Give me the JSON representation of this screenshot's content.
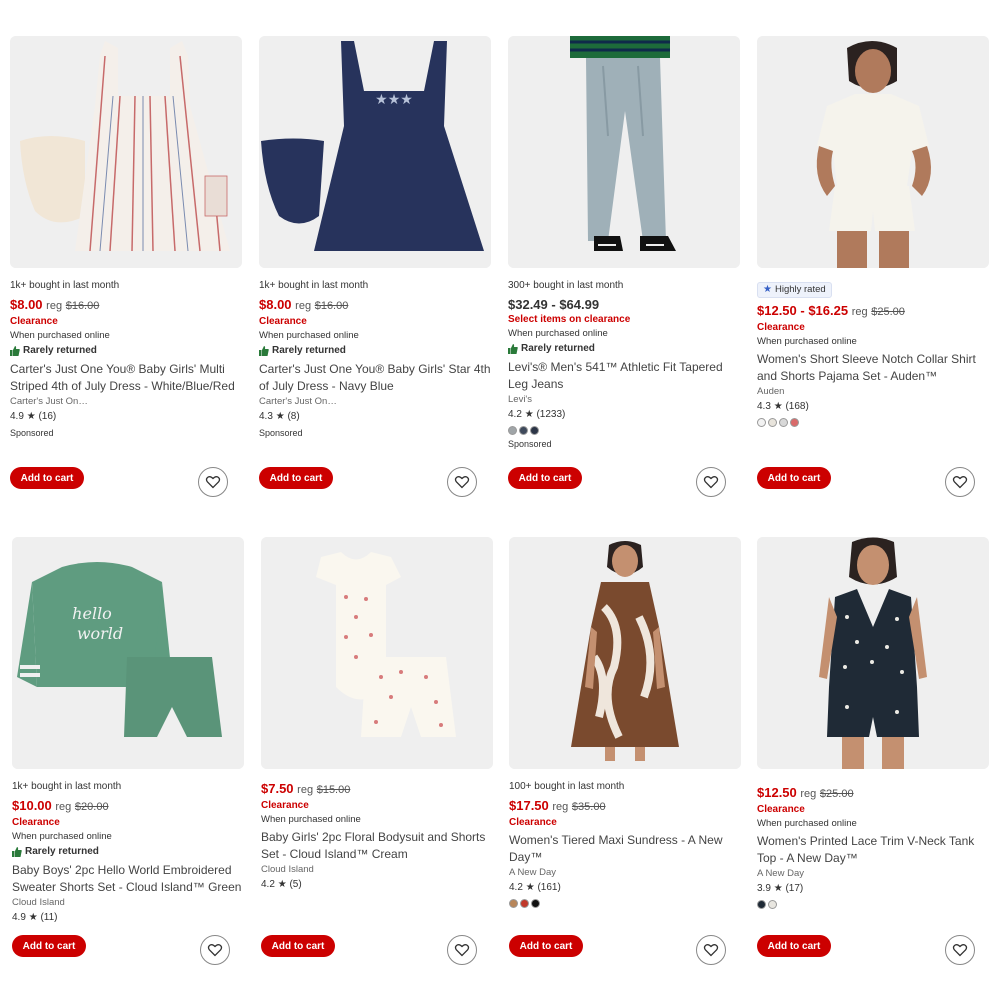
{
  "colors": {
    "accent": "#cc0000",
    "badge_star": "#3660c6"
  },
  "products": [
    {
      "bought": "1k+ bought in last month",
      "price": "$8.00",
      "reg_label": "reg",
      "reg_price": "$16.00",
      "clearance": "Clearance",
      "online": "When purchased online",
      "rarely": "Rarely returned",
      "title": "Carter's Just One You® Baby Girls' Multi Striped 4th of July Dress - White/Blue/Red",
      "brand": "Carter's Just On…",
      "rating": "4.9",
      "reviews": "(16)",
      "sponsored": "Sponsored",
      "cart": "Add to cart"
    },
    {
      "bought": "1k+ bought in last month",
      "price": "$8.00",
      "reg_label": "reg",
      "reg_price": "$16.00",
      "clearance": "Clearance",
      "online": "When purchased online",
      "rarely": "Rarely returned",
      "title": "Carter's Just One You® Baby Girls' Star 4th of July Dress - Navy Blue",
      "brand": "Carter's Just On…",
      "rating": "4.3",
      "reviews": "(8)",
      "sponsored": "Sponsored",
      "cart": "Add to cart"
    },
    {
      "bought": "300+ bought in last month",
      "price": "$32.49 - $64.99",
      "clearance": "Select items on clearance",
      "online": "When purchased online",
      "rarely": "Rarely returned",
      "title": "Levi's® Men's 541™ Athletic Fit Tapered Leg Jeans",
      "brand": "Levi's",
      "rating": "4.2",
      "reviews": "(1233)",
      "swatches": [
        "#a0a5a8",
        "#3f4a5c",
        "#2c3547"
      ],
      "sponsored": "Sponsored",
      "cart": "Add to cart"
    },
    {
      "badge": "Highly rated",
      "price": "$12.50 - $16.25",
      "reg_label": "reg",
      "reg_price": "$25.00",
      "clearance": "Clearance",
      "online": "When purchased online",
      "title": "Women's Short Sleeve Notch Collar Shirt and Shorts Pajama Set - Auden™",
      "brand": "Auden",
      "rating": "4.3",
      "reviews": "(168)",
      "swatches": [
        "#f2f2f2",
        "#e8e4dc",
        "#d8d8d8",
        "#d96a6a"
      ],
      "cart": "Add to cart"
    },
    {
      "bought": "1k+ bought in last month",
      "price": "$10.00",
      "reg_label": "reg",
      "reg_price": "$20.00",
      "clearance": "Clearance",
      "online": "When purchased online",
      "rarely": "Rarely returned",
      "title": "Baby Boys' 2pc Hello World Embroidered Sweater Shorts Set - Cloud Island™ Green",
      "brand": "Cloud Island",
      "rating": "4.9",
      "reviews": "(11)",
      "cart": "Add to cart"
    },
    {
      "price": "$7.50",
      "reg_label": "reg",
      "reg_price": "$15.00",
      "clearance": "Clearance",
      "online": "When purchased online",
      "title": "Baby Girls' 2pc Floral Bodysuit and Shorts Set - Cloud Island™ Cream",
      "brand": "Cloud Island",
      "rating": "4.2",
      "reviews": "(5)",
      "cart": "Add to cart"
    },
    {
      "bought": "100+ bought in last month",
      "price": "$17.50",
      "reg_label": "reg",
      "reg_price": "$35.00",
      "clearance": "Clearance",
      "online": "",
      "title": "Women's Tiered Maxi Sundress - A New Day™",
      "brand": "A New Day",
      "rating": "4.2",
      "reviews": "(161)",
      "swatches": [
        "#b8865a",
        "#c0392b",
        "#111111"
      ],
      "cart": "Add to cart"
    },
    {
      "price": "$12.50",
      "reg_label": "reg",
      "reg_price": "$25.00",
      "clearance": "Clearance",
      "online": "When purchased online",
      "title": "Women's Printed Lace Trim V-Neck Tank Top - A New Day™",
      "brand": "A New Day",
      "rating": "3.9",
      "reviews": "(17)",
      "swatches": [
        "#1f2a36",
        "#e8e6e0"
      ],
      "cart": "Add to cart"
    }
  ]
}
